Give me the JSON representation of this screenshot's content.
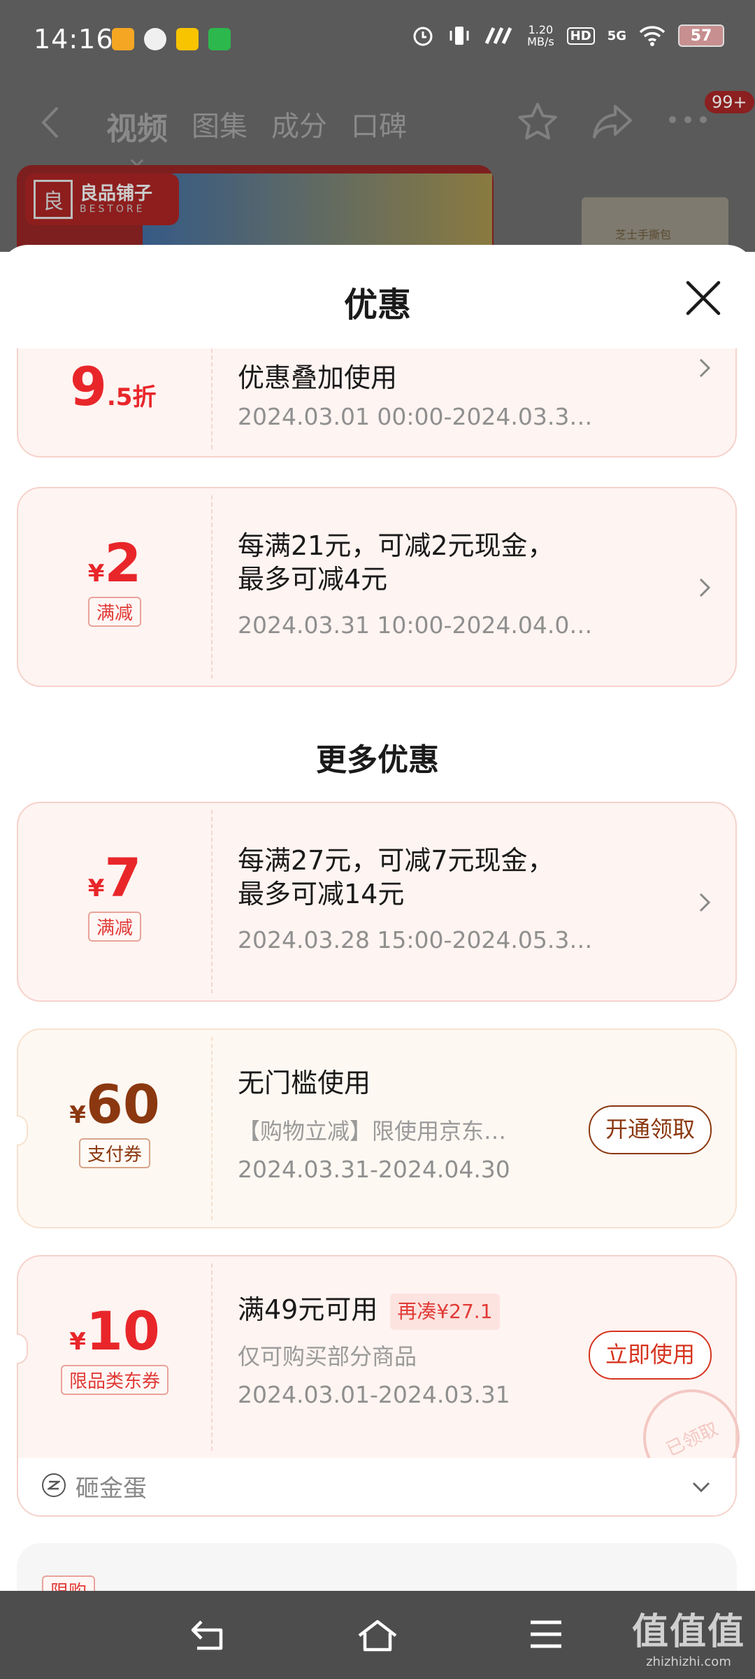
{
  "status_bar": {
    "time": "14:16",
    "net_speed_value": "1.20",
    "net_speed_unit": "MB/s",
    "hd": "HD",
    "signal": "5G",
    "battery": "57",
    "app_icon_colors": [
      "#f5a623",
      "#333333",
      "#f8c400",
      "#2db84d"
    ]
  },
  "nav": {
    "tabs": [
      "视频",
      "图集",
      "成分",
      "口碑"
    ],
    "active_tab": "视频",
    "message_badge": "99+"
  },
  "store": {
    "name_cn": "良品铺子",
    "name_en": "BESTORE",
    "logo_char": "良",
    "side_product_text": "芝士手撕包"
  },
  "sheet": {
    "title": "优惠",
    "coupons": [
      {
        "value_main": "9",
        "value_suffix": ".5折",
        "title": "优惠叠加使用",
        "date": "2024.03.01 00:00-2024.03.3…"
      },
      {
        "currency": "¥",
        "value": "2",
        "tag": "满减",
        "title_line1": "每满21元，可减2元现金，",
        "title_line2": "最多可减4元",
        "date": "2024.03.31 10:00-2024.04.0…"
      }
    ],
    "more_title": "更多优惠",
    "more_coupons": [
      {
        "currency": "¥",
        "value": "7",
        "tag": "满减",
        "title_line1": "每满27元，可减7元现金，",
        "title_line2": "最多可减14元",
        "date": "2024.03.28 15:00-2024.05.3…"
      },
      {
        "currency": "¥",
        "value": "60",
        "tag": "支付券",
        "title": "无门槛使用",
        "subtitle": "【购物立减】限使用京东…",
        "date": "2024.03.31-2024.04.30",
        "button": "开通领取"
      },
      {
        "currency": "¥",
        "value": "10",
        "tag": "限品类东券",
        "title": "满49元可用",
        "extra_tag": "再凑¥27.1",
        "subtitle": "仅可购买部分商品",
        "date": "2024.03.01-2024.03.31",
        "button": "立即使用",
        "stamp": "已领取"
      }
    ],
    "egg_label": "砸金蛋",
    "partial_tag": "限购"
  },
  "watermark": {
    "big": "值值值",
    "small": "zhizhizhi.com"
  }
}
